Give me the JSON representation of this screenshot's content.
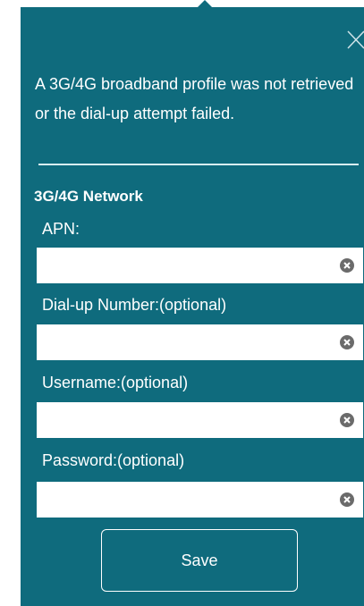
{
  "colors": {
    "panel_bg": "#0f6b7d",
    "text": "#ffffff",
    "field_bg": "#ffffff",
    "clear_icon": "#6b6b6b"
  },
  "dialog": {
    "close_icon": "close-icon",
    "message": "A 3G/4G broadband profile was not retrieved or the dial-up attempt failed.",
    "section_title": "3G/4G Network",
    "fields": [
      {
        "label": "APN:",
        "value": "",
        "placeholder": ""
      },
      {
        "label": "Dial-up Number:(optional)",
        "value": "",
        "placeholder": ""
      },
      {
        "label": "Username:(optional)",
        "value": "",
        "placeholder": ""
      },
      {
        "label": "Password:(optional)",
        "value": "",
        "placeholder": ""
      }
    ],
    "clear_icon": "clear-circle-x-icon",
    "save_label": "Save"
  }
}
